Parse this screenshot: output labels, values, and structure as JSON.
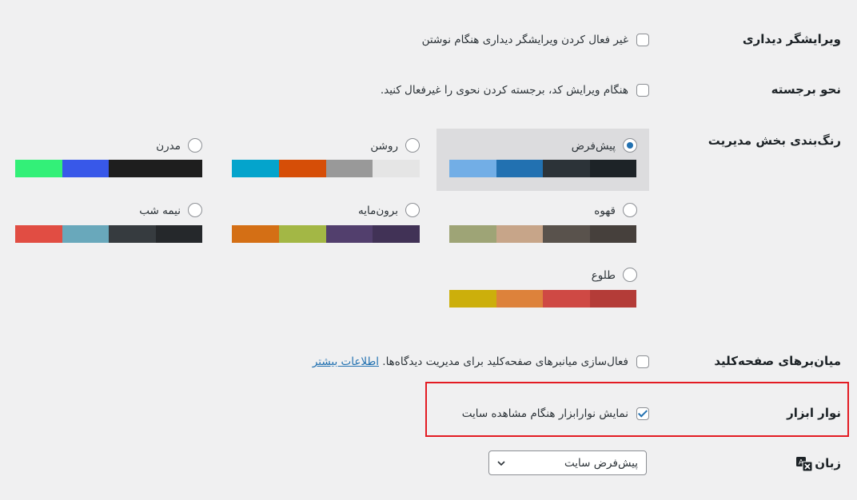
{
  "rows": {
    "visual_editor": {
      "label": "ویرایشگر دیداری",
      "option": "غیر فعال کردن ویرایشگر دیداری هنگام نوشتن",
      "checked": false
    },
    "syntax_highlight": {
      "label": "نحو برجسته",
      "option": "هنگام ویرایش کد، برجسته کردن نحوی را غیرفعال کنید.",
      "checked": false
    },
    "admin_color": {
      "label": "رنگ‌بندی بخش مدیریت",
      "schemes": [
        {
          "name": "پیش‌فرض",
          "selected": true,
          "colors": [
            "#1d2327",
            "#2c3338",
            "#2271b1",
            "#72aee6"
          ]
        },
        {
          "name": "روشن",
          "selected": false,
          "colors": [
            "#e5e5e5",
            "#999999",
            "#d64e07",
            "#04a4cc"
          ]
        },
        {
          "name": "مدرن",
          "selected": false,
          "colors": [
            "#1e1e1e",
            "#1e1e1e",
            "#3858e9",
            "#33f078"
          ]
        },
        {
          "name": "قهوه",
          "selected": false,
          "colors": [
            "#46403c",
            "#59524c",
            "#c7a589",
            "#9ea476"
          ]
        },
        {
          "name": "برون‌مایه",
          "selected": false,
          "colors": [
            "#413256",
            "#523f6d",
            "#a3b745",
            "#d46f15"
          ]
        },
        {
          "name": "نیمه شب",
          "selected": false,
          "colors": [
            "#25282b",
            "#363b3f",
            "#69a8bb",
            "#e14d43"
          ]
        },
        {
          "name": "طلوع",
          "selected": false,
          "colors": [
            "#b43c38",
            "#cf4944",
            "#dd823b",
            "#ccaf0b"
          ]
        }
      ]
    },
    "keyboard_shortcuts": {
      "label": "میان‌برهای صفحه‌کلید",
      "option": "فعال‌سازی میانبرهای صفحه‌کلید برای مدیریت دیدگاه‌ها.",
      "link": "اطلاعات بیشتر",
      "checked": false
    },
    "toolbar": {
      "label": "نوار ابزار",
      "option": "نمایش نوارابزار هنگام مشاهده سایت",
      "checked": true
    },
    "language": {
      "label": "زبان",
      "selected": "پیش‌فرض سایت",
      "icon": "translation-icon"
    }
  },
  "colors": {
    "accent": "#2271b1",
    "highlight_border": "#e31b23"
  }
}
